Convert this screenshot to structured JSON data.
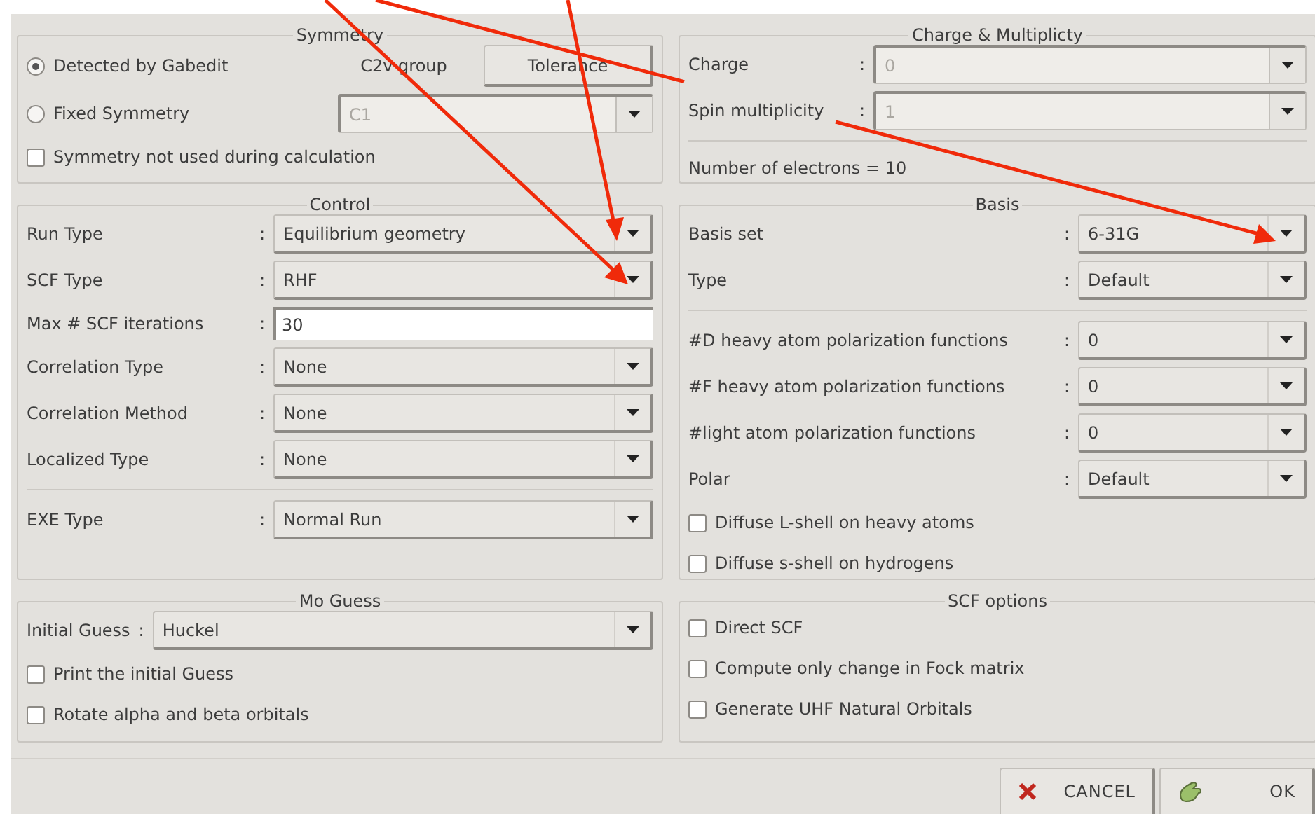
{
  "sections": [
    {
      "title": "Symmetry",
      "rows": [
        {
          "kind": "radio",
          "label": "Detected by Gabedit",
          "selected": true,
          "note": "C2v group",
          "button": "Tolerance"
        },
        {
          "kind": "radio",
          "label": "Fixed Symmetry",
          "selected": false,
          "value": "C1",
          "disabled": true
        },
        {
          "kind": "check",
          "label": "Symmetry not used during calculation",
          "checked": false
        }
      ]
    },
    {
      "title": "Charge & Multiplicty",
      "rows": [
        {
          "kind": "combo",
          "label": "Charge",
          "separator": ":",
          "value": "0",
          "disabled": true
        },
        {
          "kind": "combo",
          "label": "Spin multiplicity",
          "separator": ":",
          "value": "1",
          "disabled": true
        },
        {
          "kind": "divider"
        },
        {
          "kind": "info",
          "text": "Number of electrons = 10"
        }
      ]
    },
    {
      "title": "Control",
      "rows": [
        {
          "kind": "combo",
          "label": "Run Type",
          "separator": ":",
          "value": "Equilibrium geometry",
          "disabled": false
        },
        {
          "kind": "combo",
          "label": "SCF Type",
          "separator": ":",
          "value": "RHF",
          "disabled": false
        },
        {
          "kind": "entry",
          "label": "Max # SCF iterations",
          "separator": ":",
          "value": "30"
        },
        {
          "kind": "combo",
          "label": "Correlation Type",
          "separator": ":",
          "value": "None",
          "disabled": false
        },
        {
          "kind": "combo",
          "label": "Correlation Method",
          "separator": ":",
          "value": "None",
          "disabled": false
        },
        {
          "kind": "combo",
          "label": "Localized Type",
          "separator": ":",
          "value": "None",
          "disabled": false
        },
        {
          "kind": "divider"
        },
        {
          "kind": "combo",
          "label": "EXE Type",
          "separator": ":",
          "value": "Normal Run",
          "disabled": false
        }
      ]
    },
    {
      "title": "Basis",
      "rows": [
        {
          "kind": "combo",
          "label": "Basis set",
          "separator": ":",
          "value": "6-31G",
          "disabled": false
        },
        {
          "kind": "combo",
          "label": "Type",
          "separator": ":",
          "value": "Default",
          "disabled": false
        },
        {
          "kind": "divider"
        },
        {
          "kind": "combo",
          "label": "#D heavy atom polarization functions",
          "separator": ":",
          "value": "0",
          "disabled": false
        },
        {
          "kind": "combo",
          "label": "#F heavy atom polarization functions",
          "separator": ":",
          "value": "0",
          "disabled": false
        },
        {
          "kind": "combo",
          "label": "#light atom polarization functions",
          "separator": ":",
          "value": "0",
          "disabled": false
        },
        {
          "kind": "combo",
          "label": "Polar",
          "separator": ":",
          "value": "Default",
          "disabled": false
        },
        {
          "kind": "check",
          "label": "Diffuse L-shell on heavy atoms",
          "checked": false
        },
        {
          "kind": "check",
          "label": "Diffuse s-shell on hydrogens",
          "checked": false
        }
      ]
    },
    {
      "title": "Mo Guess",
      "rows": [
        {
          "kind": "combo",
          "label": "Initial Guess",
          "separator": ":",
          "value": "Huckel",
          "disabled": false
        },
        {
          "kind": "check",
          "label": "Print the initial Guess",
          "checked": false
        },
        {
          "kind": "check",
          "label": "Rotate alpha and beta orbitals",
          "checked": false
        }
      ]
    },
    {
      "title": "SCF options",
      "rows": [
        {
          "kind": "check",
          "label": "Direct SCF",
          "checked": false
        },
        {
          "kind": "check",
          "label": "Compute only change in Fock matrix",
          "checked": false
        },
        {
          "kind": "check",
          "label": "Generate UHF Natural Orbitals",
          "checked": false
        }
      ]
    }
  ],
  "buttons": [
    {
      "kind": "cancel",
      "label": "CANCEL"
    },
    {
      "kind": "ok",
      "label": "OK"
    }
  ]
}
